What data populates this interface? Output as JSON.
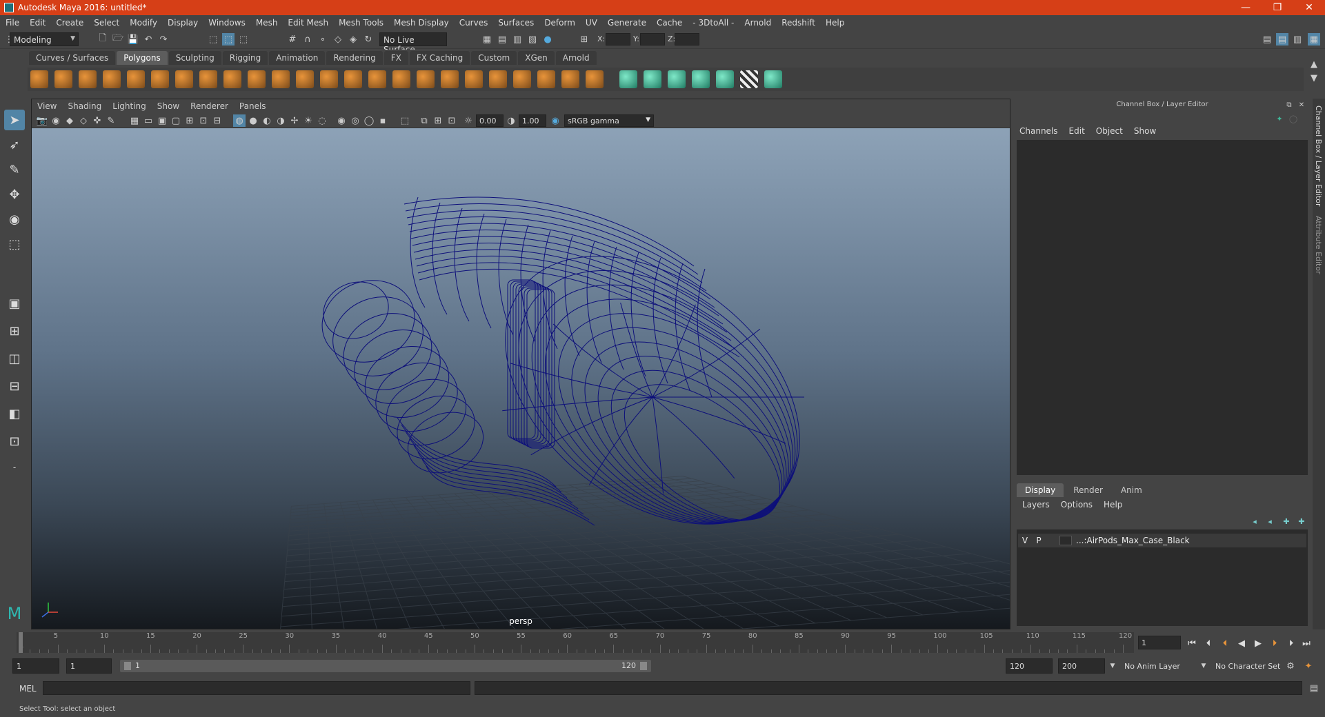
{
  "window": {
    "title": "Autodesk Maya 2016: untitled*",
    "controls": [
      "—",
      "❐",
      "✕"
    ]
  },
  "menubar": [
    "File",
    "Edit",
    "Create",
    "Select",
    "Modify",
    "Display",
    "Windows",
    "Mesh",
    "Edit Mesh",
    "Mesh Tools",
    "Mesh Display",
    "Curves",
    "Surfaces",
    "Deform",
    "UV",
    "Generate",
    "Cache",
    "- 3DtoAll -",
    "Arnold",
    "Redshift",
    "Help"
  ],
  "statusline": {
    "mode": "Modeling",
    "live_surface": "No Live Surface",
    "coord_x": "X:",
    "coord_y": "Y:",
    "coord_z": "Z:"
  },
  "shelf": {
    "tabs": [
      "Curves / Surfaces",
      "Polygons",
      "Sculpting",
      "Rigging",
      "Animation",
      "Rendering",
      "FX",
      "FX Caching",
      "Custom",
      "XGen",
      "Arnold"
    ],
    "active_tab": "Polygons",
    "icon_colors": [
      "#e8943a",
      "#e8943a",
      "#e8943a",
      "#e8943a",
      "#e8943a",
      "#e8943a",
      "#e8943a",
      "#e8943a",
      "#e8943a",
      "#e8943a",
      "#e8943a",
      "#e8943a",
      "#e8943a",
      "#e8943a",
      "#e8943a",
      "#e8943a",
      "#e8943a",
      "#e8943a",
      "#e8943a",
      "#e8943a",
      "#e8943a",
      "#e8943a",
      "#e8943a",
      "#e8943a",
      "#3fb99a",
      "#3fb99a",
      "#3fb99a",
      "#3fb99a",
      "#3fb99a",
      "#cccccc",
      "#3fb99a"
    ]
  },
  "viewport": {
    "menu": [
      "View",
      "Shading",
      "Lighting",
      "Show",
      "Renderer",
      "Panels"
    ],
    "exposure": "0.00",
    "gamma": "1.00",
    "color_space": "sRGB gamma",
    "camera_label": "persp",
    "wire_color": "#0d0f7a"
  },
  "timeslider": {
    "ticks": [
      "5",
      "10",
      "15",
      "20",
      "25",
      "30",
      "35",
      "40",
      "45",
      "50",
      "55",
      "60",
      "65",
      "70",
      "75",
      "80",
      "85",
      "90",
      "95",
      "100",
      "105",
      "110",
      "115",
      "120"
    ],
    "current_frame_label": "1",
    "current_frame": "1"
  },
  "range": {
    "start": "1",
    "playback_start": "1",
    "slider_start": "1",
    "slider_end": "120",
    "playback_end": "120",
    "end": "200",
    "anim_layer": "No Anim Layer",
    "character_set": "No Character Set"
  },
  "command": {
    "label": "MEL"
  },
  "help": {
    "text": "Select Tool: select an object"
  },
  "right_panel": {
    "title": "Channel Box / Layer Editor",
    "menu": [
      "Channels",
      "Edit",
      "Object",
      "Show"
    ],
    "tabs": [
      "Display",
      "Render",
      "Anim"
    ],
    "active_tab": "Display",
    "layer_menu": [
      "Layers",
      "Options",
      "Help"
    ],
    "layer": {
      "visible": "V",
      "playback": "P",
      "name": "...:AirPods_Max_Case_Black"
    },
    "side_tabs": [
      "Channel Box / Layer Editor",
      "Attribute Editor"
    ]
  }
}
